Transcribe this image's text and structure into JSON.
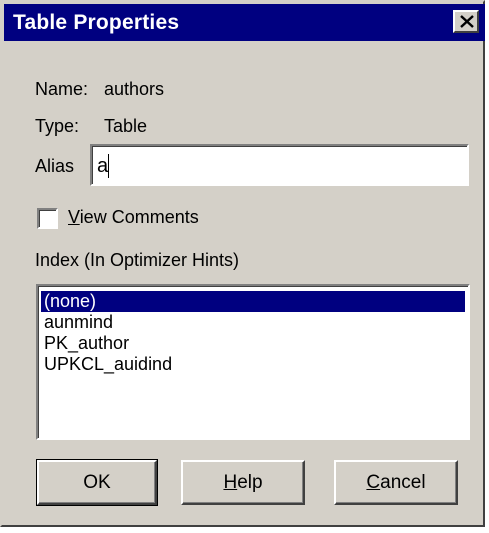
{
  "window": {
    "title": "Table Properties",
    "close_icon": "close-icon"
  },
  "fields": {
    "name_label": "Name:",
    "name_value": "authors",
    "type_label": "Type:",
    "type_value": "Table",
    "alias_label": "Alias",
    "alias_value": "a"
  },
  "view_comments": {
    "accel": "V",
    "rest": "iew Comments",
    "checked": false
  },
  "index": {
    "label": "Index (In Optimizer Hints)",
    "items": [
      "(none)",
      "aunmind",
      "PK_author",
      "UPKCL_auidind"
    ],
    "selected": "(none)"
  },
  "buttons": {
    "ok": "OK",
    "help_accel": "H",
    "help_rest": "elp",
    "cancel_accel": "C",
    "cancel_rest": "ancel"
  },
  "colors": {
    "titlebar": "#000080",
    "face": "#d4d0c8",
    "selection": "#000080"
  }
}
